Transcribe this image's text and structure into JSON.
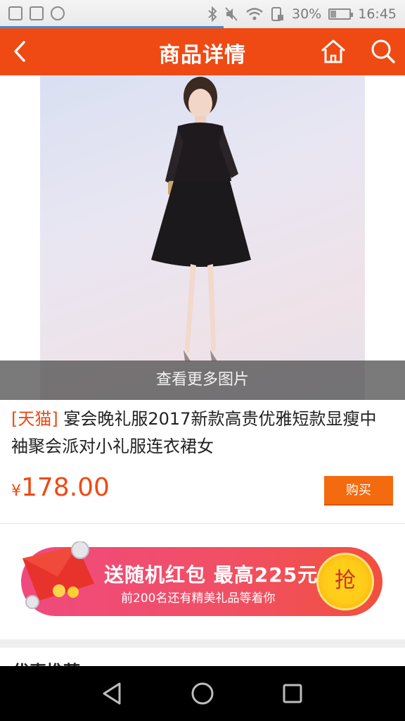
{
  "status_bar": {
    "battery_text": "30%",
    "battery_level": 0.3,
    "time": "16:45",
    "icons": [
      "image-icon",
      "keyboard-icon",
      "block-icon",
      "bluetooth-icon",
      "mute-icon",
      "wifi-icon",
      "sim-icon",
      "battery-icon"
    ]
  },
  "app_bar": {
    "title": "商品详情",
    "icons": [
      "back-arrow-icon",
      "home-icon",
      "search-icon"
    ]
  },
  "product": {
    "more_photos": "查看更多图片",
    "tag": "[天猫]",
    "title": "宴会晚礼服2017新款高贵优雅短款显瘦中袖聚会派对小礼服连衣裙女",
    "currency": "¥",
    "price": "178.00",
    "buy_label": "购买"
  },
  "banner": {
    "headline": "送随机红包 最高225元",
    "subtext": "前200名还有精美礼品等着你",
    "grab_label": "抢"
  },
  "next_section": {
    "peek_text": "优惠推荐"
  },
  "nav_bar": {
    "icons": [
      "back-triangle-icon",
      "home-circle-icon",
      "recents-square-icon"
    ]
  },
  "colors": {
    "accent": "#ef4a13",
    "buy_button": "#f46a0e",
    "banner_start": "#ef4a7e",
    "banner_end": "#f1503e"
  }
}
